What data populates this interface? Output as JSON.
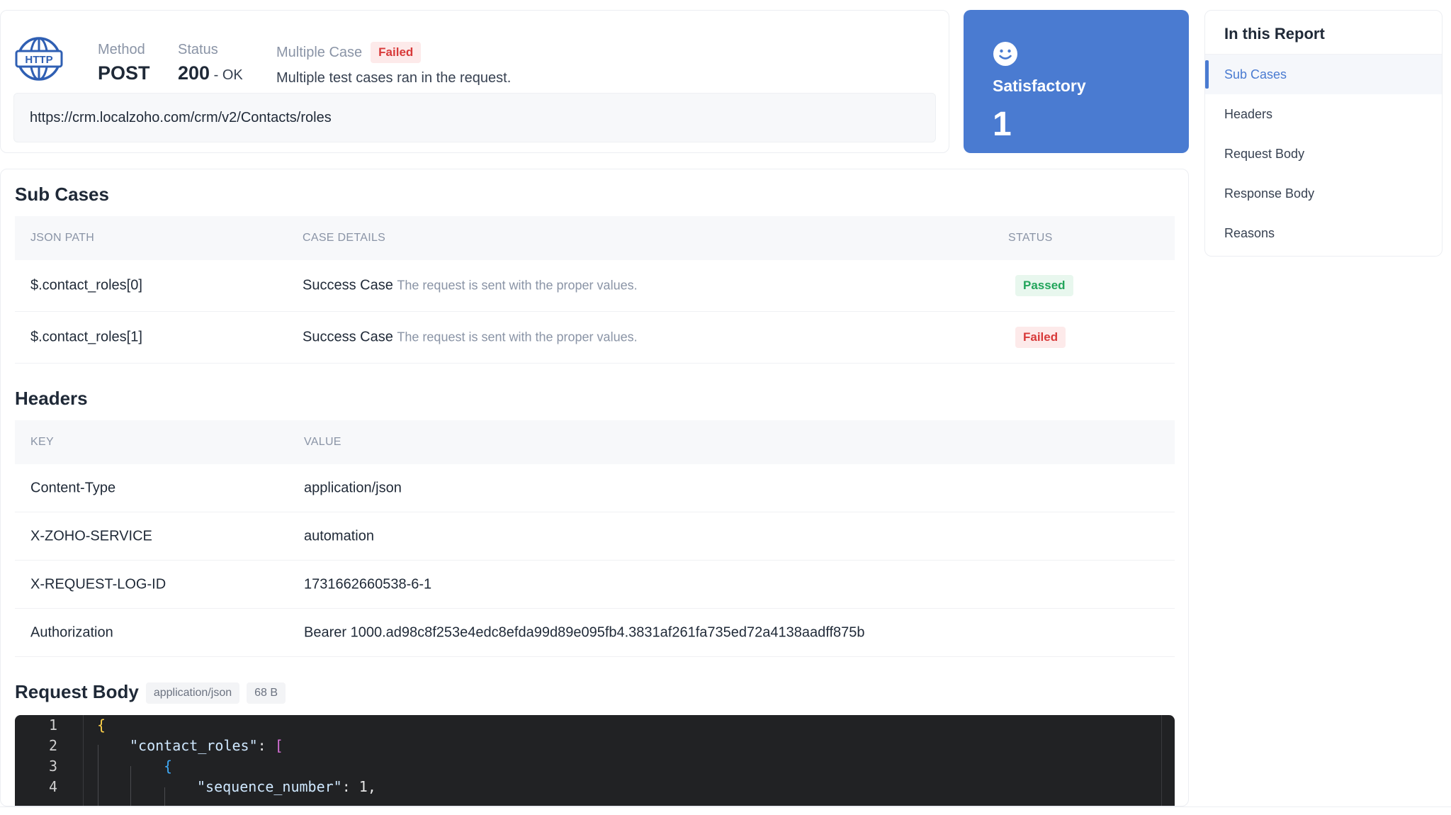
{
  "summary": {
    "method_label": "Method",
    "method_value": "POST",
    "status_label": "Status",
    "status_code": "200",
    "status_text": " - OK",
    "multi_label": "Multiple Case",
    "multi_badge": "Failed",
    "multi_desc": "Multiple test cases ran in the request.",
    "url": "https://crm.localzoho.com/crm/v2/Contacts/roles",
    "icon": "http-globe-icon"
  },
  "satisfactory": {
    "label": "Satisfactory",
    "count": "1",
    "icon": "smiley-icon",
    "color": "#4a7bd1"
  },
  "toc": {
    "title": "In this Report",
    "items": [
      {
        "label": "Sub Cases",
        "active": true
      },
      {
        "label": "Headers",
        "active": false
      },
      {
        "label": "Request Body",
        "active": false
      },
      {
        "label": "Response Body",
        "active": false
      },
      {
        "label": "Reasons",
        "active": false
      }
    ]
  },
  "sub_cases": {
    "title": "Sub Cases",
    "columns": [
      "JSON PATH",
      "CASE DETAILS",
      "STATUS"
    ],
    "rows": [
      {
        "path": "$.contact_roles[0]",
        "case": "Success Case",
        "detail": "The request is sent with the proper values.",
        "status": "Passed"
      },
      {
        "path": "$.contact_roles[1]",
        "case": "Success Case",
        "detail": "The request is sent with the proper values.",
        "status": "Failed"
      }
    ]
  },
  "headers": {
    "title": "Headers",
    "columns": [
      "KEY",
      "VALUE"
    ],
    "rows": [
      {
        "key": "Content-Type",
        "value": "application/json"
      },
      {
        "key": "X-ZOHO-SERVICE",
        "value": "automation"
      },
      {
        "key": "X-REQUEST-LOG-ID",
        "value": "1731662660538-6-1"
      },
      {
        "key": "Authorization",
        "value": "Bearer 1000.ad98c8f253e4edc8efda99d89e095fb4.3831af261fa735ed72a4138aadff875b"
      }
    ]
  },
  "request_body": {
    "title": "Request Body",
    "content_type": "application/json",
    "size": "68 B",
    "lines": [
      {
        "n": "1",
        "text": "{"
      },
      {
        "n": "2",
        "key": "\"contact_roles\"",
        "rest": ": ",
        "bracket": "["
      },
      {
        "n": "3",
        "text": "{"
      },
      {
        "n": "4",
        "key": "\"sequence_number\"",
        "rest": ": 1,"
      }
    ]
  },
  "colors": {
    "accent": "#4a7bd1",
    "passed": "#22a55b",
    "failed": "#d83a3a"
  }
}
